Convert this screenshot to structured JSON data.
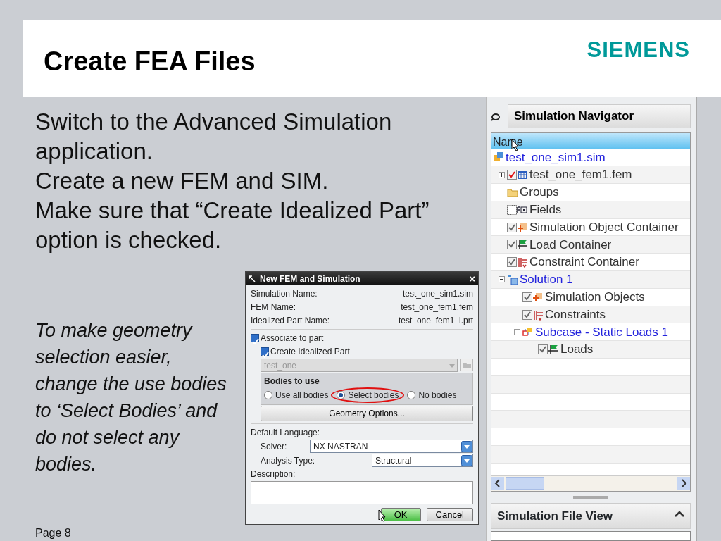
{
  "slide": {
    "title": "Create FEA Files",
    "logo": "SIEMENS",
    "bullets": [
      "Switch to the Advanced Simulation application.",
      "Create a new FEM and SIM.",
      "Make sure that “Create Idealized Part” option is checked."
    ],
    "note": "To make geometry selection easier, change the use bodies to ‘Select Bodies’ and do not select any bodies.",
    "page": "Page 8"
  },
  "dialog": {
    "title": "New FEM and Simulation",
    "close": "×",
    "names": [
      {
        "label": "Simulation Name:",
        "value": "test_one_sim1.sim"
      },
      {
        "label": "FEM Name:",
        "value": "test_one_fem1.fem"
      },
      {
        "label": "Idealized Part Name:",
        "value": "test_one_fem1_i.prt"
      }
    ],
    "associate": {
      "label": "Associate to part",
      "checked": true
    },
    "create_idealized": {
      "label": "Create Idealized Part",
      "checked": true
    },
    "part": {
      "value": "test_one",
      "disabled": true
    },
    "bodies": {
      "title": "Bodies to use",
      "options": [
        {
          "label": "Use all bodies",
          "selected": false
        },
        {
          "label": "Select bodies",
          "selected": true,
          "highlighted": true
        },
        {
          "label": "No bodies",
          "selected": false
        }
      ]
    },
    "geometry_button": "Geometry Options...",
    "language_label": "Default Language:",
    "solver": {
      "label": "Solver:",
      "value": "NX NASTRAN"
    },
    "analysis": {
      "label": "Analysis Type:",
      "value": "Structural"
    },
    "description_label": "Description:",
    "buttons": [
      {
        "label": "OK",
        "kind": "primary"
      },
      {
        "label": "Cancel",
        "kind": "normal"
      }
    ]
  },
  "navigator": {
    "title": "Simulation Navigator",
    "column": "Name",
    "tree": [
      {
        "label": "test_one_sim1.sim",
        "kind": "sim",
        "children": [
          {
            "label": "test_one_fem1.fem",
            "kind": "fem",
            "checked": true,
            "expanded": false
          },
          {
            "label": "Groups",
            "kind": "folder"
          },
          {
            "label": "Fields",
            "kind": "fields",
            "checked": false
          },
          {
            "label": "Simulation Object Container",
            "kind": "simobj",
            "checked": true
          },
          {
            "label": "Load Container",
            "kind": "load",
            "checked": true
          },
          {
            "label": "Constraint Container",
            "kind": "constraint",
            "checked": true
          },
          {
            "label": "Solution 1",
            "kind": "solution",
            "expanded": true,
            "children": [
              {
                "label": "Simulation Objects",
                "kind": "simobj",
                "checked": true
              },
              {
                "label": "Constraints",
                "kind": "constraint",
                "checked": true
              },
              {
                "label": "Subcase - Static Loads 1",
                "kind": "subcase",
                "expanded": true,
                "children": [
                  {
                    "label": "Loads",
                    "kind": "load",
                    "checked": true
                  }
                ]
              }
            ]
          }
        ]
      }
    ]
  },
  "file_view": {
    "title": "Simulation File View"
  }
}
